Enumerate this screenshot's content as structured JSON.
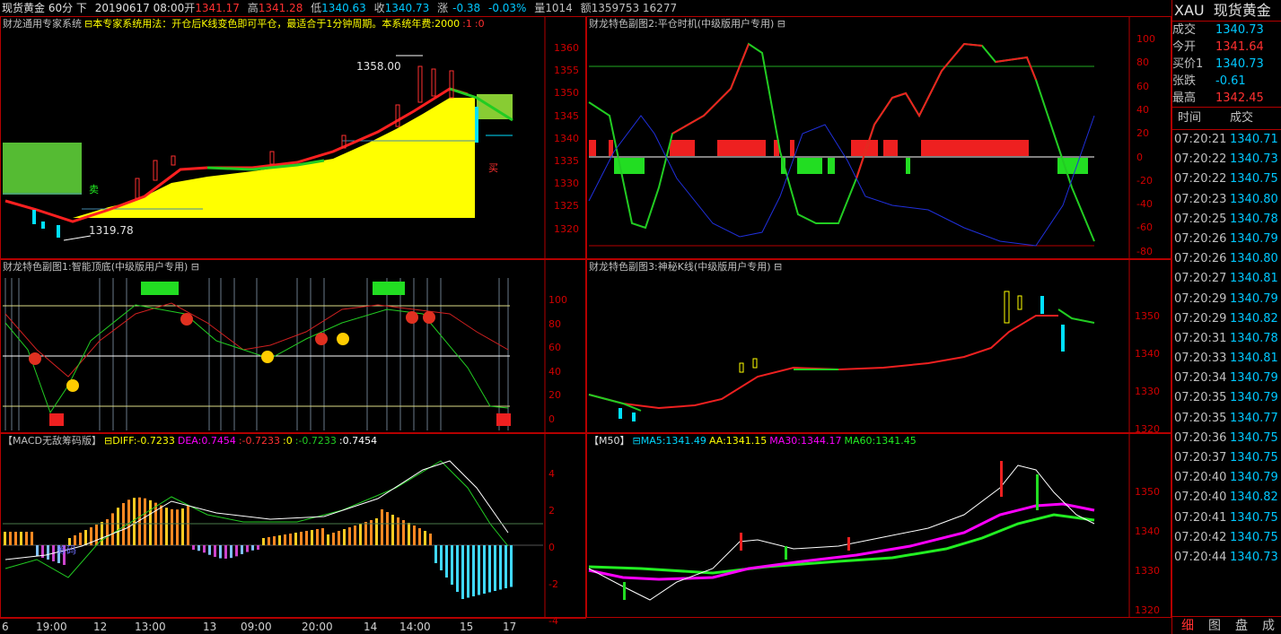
{
  "topbar": {
    "symbol": "现货黄金 60分 下",
    "date": "20190617 08:00",
    "open_k": "开",
    "open": "1341.17",
    "high_k": "高",
    "high": "1341.28",
    "low_k": "低",
    "low": "1340.63",
    "close_k": "收",
    "close": "1340.73",
    "chg_k": "涨",
    "chg": "-0.38",
    "pct": "-0.03%",
    "vol": "量1014",
    "amt": "额1359753 16277"
  },
  "panels": {
    "main": {
      "title": "财龙通用专家系统",
      "desc": "⊟本专家系统用法：开仓后K线变色即可平仓，最适合于1分钟周期。本系统年费:2000",
      "v1": ":1",
      "v2": ":0",
      "hi_label": "1358.00",
      "lo_label": "1319.78",
      "sell": "卖",
      "buy": "买",
      "axis": [
        "1360",
        "1355",
        "1350",
        "1345",
        "1340",
        "1335",
        "1330",
        "1325",
        "1320"
      ]
    },
    "fig1": {
      "title": "财龙特色副图1:智能顶底(中级版用户专用) ⊟",
      "axis": [
        "100",
        "80",
        "60",
        "40",
        "20",
        "0"
      ]
    },
    "macd": {
      "title": "【MACD无敌筹码版】",
      "diff": "⊟DIFF:-0.7233",
      "dea": "DEA:0.7454",
      "c": ":-0.7233",
      "d": ":0",
      "e": ":-0.7233",
      "f": ":0.7454",
      "overlay": "筹码",
      "axis": [
        "4",
        "2",
        "0",
        "-2",
        "-4"
      ]
    },
    "fig2": {
      "title": "财龙特色副图2:平仓时机(中级版用户专用) ⊟",
      "axis": [
        "100",
        "80",
        "60",
        "40",
        "20",
        "0",
        "-20",
        "-40",
        "-60",
        "-80"
      ]
    },
    "fig3": {
      "title": "财龙特色副图3:神秘K线(中级版用户专用) ⊟",
      "axis": [
        "1350",
        "1340",
        "1330",
        "1320"
      ]
    },
    "ma": {
      "title": "【M50】",
      "ma5": "⊟MA5:1341.49",
      "aa": "AA:1341.15",
      "ma30": "MA30:1344.17",
      "ma60": "MA60:1341.45",
      "axis": [
        "1350",
        "1340",
        "1330",
        "1320"
      ]
    }
  },
  "xaxis": [
    "6",
    "19:00",
    "12",
    "13:00",
    "13",
    "09:00",
    "20:00",
    "14",
    "14:00",
    "15",
    "17"
  ],
  "side": {
    "code": "XAU",
    "name": "现货黄金",
    "quotes": [
      {
        "k": "成交",
        "v": "1340.73",
        "c": "#00c8ff"
      },
      {
        "k": "今开",
        "v": "1341.64",
        "c": "#ff3030"
      },
      {
        "k": "买价1",
        "v": "1340.73",
        "c": "#00c8ff"
      },
      {
        "k": "张跌",
        "v": "-0.61",
        "c": "#00c8ff"
      },
      {
        "k": "最高",
        "v": "1342.45",
        "c": "#ff3030"
      }
    ],
    "tick_head": {
      "time": "时间",
      "price": "成交"
    },
    "ticks": [
      {
        "t": "07:20:21",
        "p": "1340.71"
      },
      {
        "t": "07:20:22",
        "p": "1340.73"
      },
      {
        "t": "07:20:22",
        "p": "1340.75"
      },
      {
        "t": "07:20:23",
        "p": "1340.80"
      },
      {
        "t": "07:20:25",
        "p": "1340.78"
      },
      {
        "t": "07:20:26",
        "p": "1340.79"
      },
      {
        "t": "07:20:26",
        "p": "1340.80"
      },
      {
        "t": "07:20:27",
        "p": "1340.81"
      },
      {
        "t": "07:20:29",
        "p": "1340.79"
      },
      {
        "t": "07:20:29",
        "p": "1340.82"
      },
      {
        "t": "07:20:31",
        "p": "1340.78"
      },
      {
        "t": "07:20:33",
        "p": "1340.81"
      },
      {
        "t": "07:20:34",
        "p": "1340.79"
      },
      {
        "t": "07:20:35",
        "p": "1340.79"
      },
      {
        "t": "07:20:35",
        "p": "1340.77"
      },
      {
        "t": "07:20:36",
        "p": "1340.75"
      },
      {
        "t": "07:20:37",
        "p": "1340.75"
      },
      {
        "t": "07:20:40",
        "p": "1340.79"
      },
      {
        "t": "07:20:40",
        "p": "1340.82"
      },
      {
        "t": "07:20:41",
        "p": "1340.75"
      },
      {
        "t": "07:20:42",
        "p": "1340.75"
      },
      {
        "t": "07:20:44",
        "p": "1340.73"
      }
    ],
    "tabs": [
      "细",
      "图",
      "盘",
      "成"
    ]
  },
  "colors": {
    "up": "#ff3030",
    "down": "#00e0ff",
    "border": "#b40000",
    "yellow": "#ffff00",
    "green": "#00ff00",
    "magenta": "#ff00ff"
  }
}
